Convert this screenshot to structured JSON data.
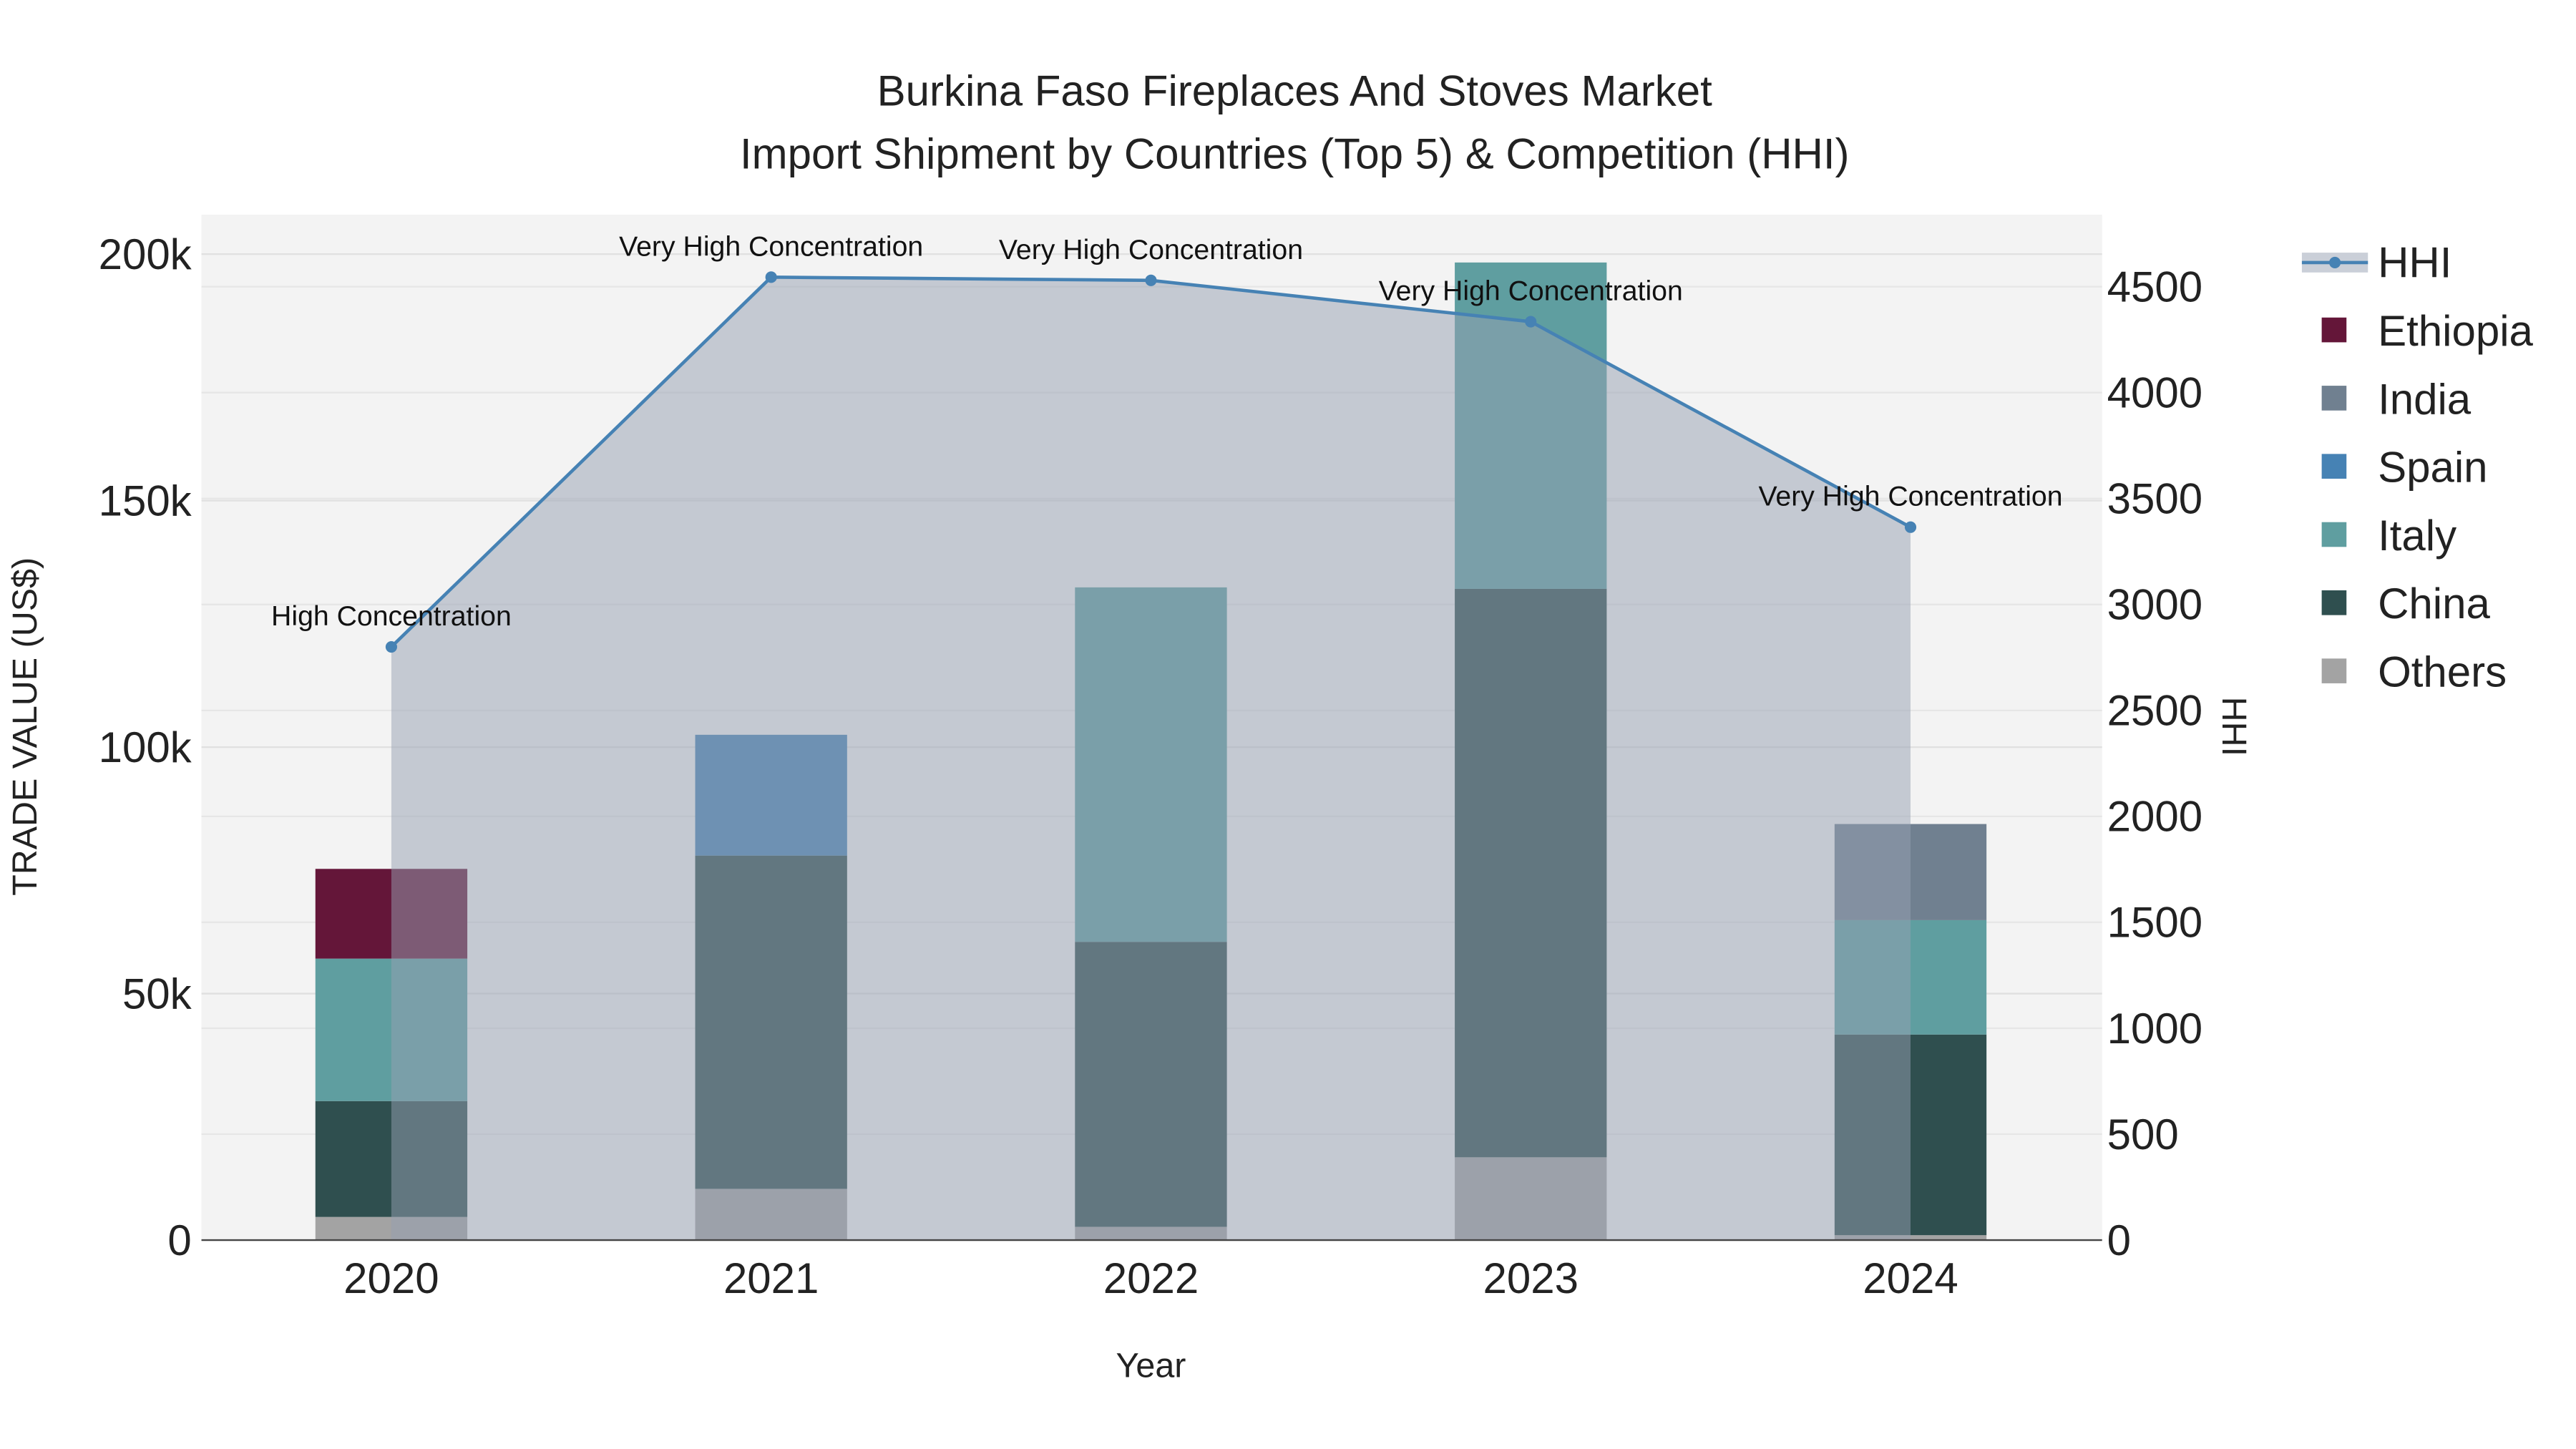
{
  "chart_data": {
    "type": "bar",
    "title": "Burkina Faso Fireplaces And Stoves Market",
    "subtitle": "Import Shipment by Countries (Top 5) & Competition (HHI)",
    "xlabel": "Year",
    "ylabel": "TRADE VALUE (US$)",
    "y2label": "HHI",
    "categories": [
      "2020",
      "2021",
      "2022",
      "2023",
      "2024"
    ],
    "ylim": [
      0,
      208000
    ],
    "y2lim": [
      0,
      4840
    ],
    "yticks": [
      {
        "v": 0,
        "label": "0"
      },
      {
        "v": 50000,
        "label": "50k"
      },
      {
        "v": 100000,
        "label": "100k"
      },
      {
        "v": 150000,
        "label": "150k"
      },
      {
        "v": 200000,
        "label": "200k"
      }
    ],
    "y2ticks": [
      0,
      500,
      1000,
      1500,
      2000,
      2500,
      3000,
      3500,
      4000,
      4500
    ],
    "stacked": true,
    "series": [
      {
        "name": "Others",
        "color": "#a3a3a3",
        "values": [
          4700,
          10400,
          2700,
          16800,
          1000
        ]
      },
      {
        "name": "China",
        "color": "#2f4f4f",
        "values": [
          23500,
          67600,
          57800,
          115300,
          40700
        ]
      },
      {
        "name": "Italy",
        "color": "#5f9ea0",
        "values": [
          28900,
          0,
          71900,
          66200,
          23200
        ]
      },
      {
        "name": "Spain",
        "color": "#4682b4",
        "values": [
          0,
          24500,
          0,
          0,
          0
        ]
      },
      {
        "name": "India",
        "color": "#708090",
        "values": [
          0,
          0,
          0,
          0,
          19500
        ]
      },
      {
        "name": "Ethiopia",
        "color": "#641639",
        "values": [
          18200,
          0,
          0,
          0,
          0
        ]
      }
    ],
    "hhi": {
      "name": "HHI",
      "color": "#4682b4",
      "values": [
        2800,
        4545,
        4530,
        4335,
        3365
      ],
      "labels": [
        "High Concentration",
        "Very High Concentration",
        "Very High Concentration",
        "Very High Concentration",
        "Very High Concentration"
      ]
    },
    "legend": [
      "HHI",
      "Ethiopia",
      "India",
      "Spain",
      "Italy",
      "China",
      "Others"
    ],
    "legend_position": "right"
  }
}
